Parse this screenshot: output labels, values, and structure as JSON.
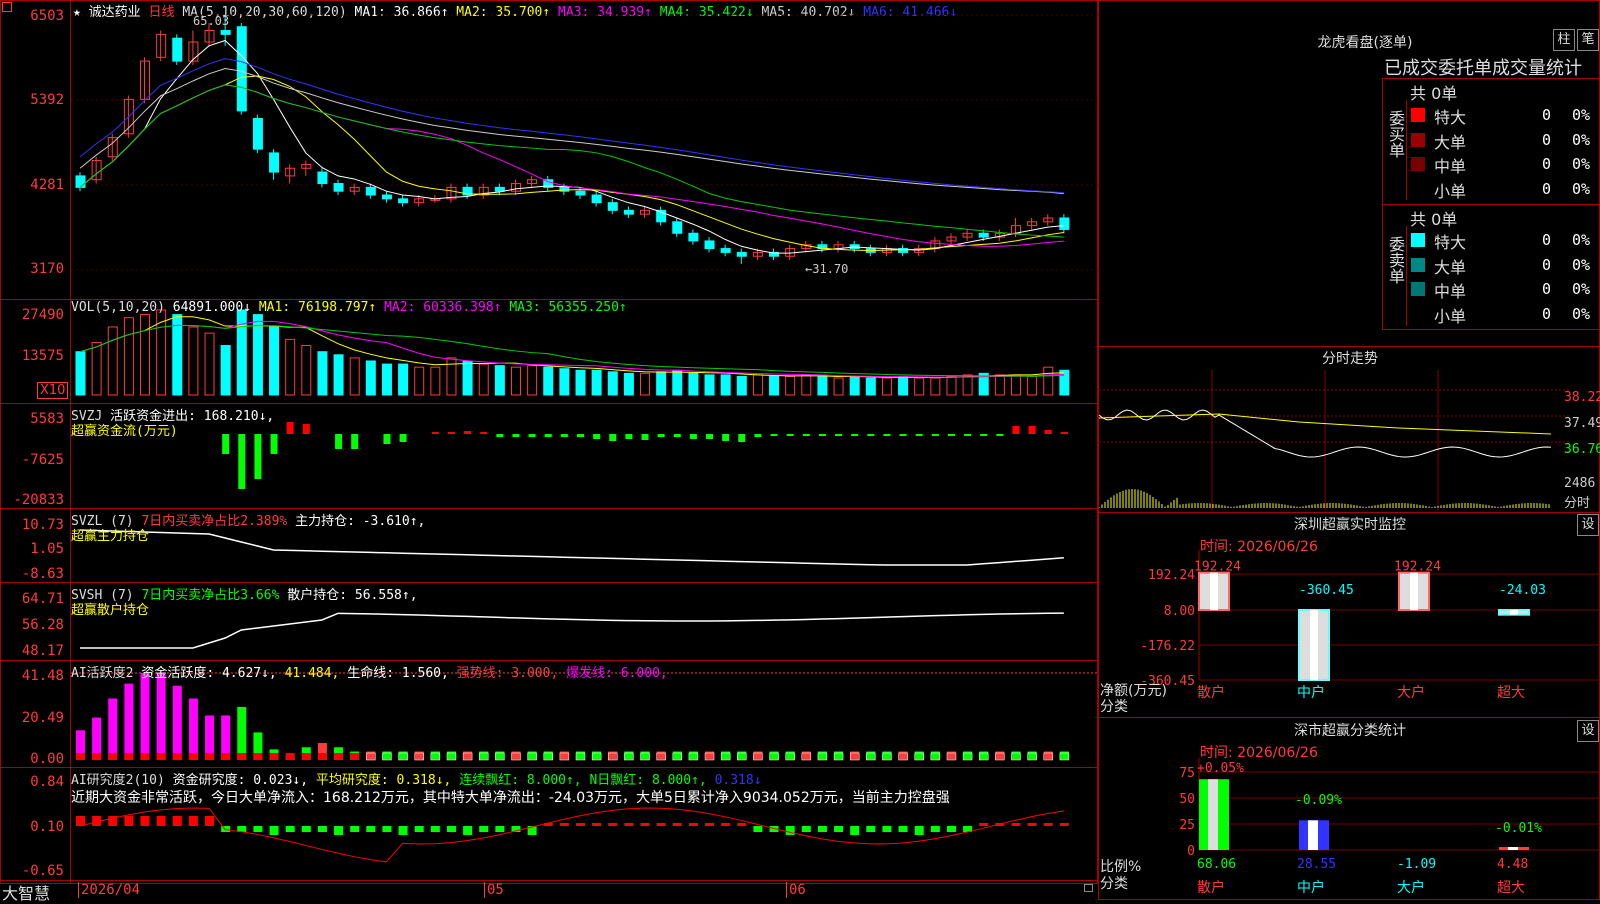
{
  "title": {
    "stock_name": "诚达药业",
    "period": "日线",
    "ma_prefix": "MA(5,10,20,30,60,120)",
    "ma": [
      {
        "label": "MA1: 36.866↑",
        "color": "#ffffff"
      },
      {
        "label": "MA2: 35.700↑",
        "color": "#ffff00"
      },
      {
        "label": "MA3: 34.939↑",
        "color": "#ff00ff"
      },
      {
        "label": "MA4: 35.422↓",
        "color": "#00ff00"
      },
      {
        "label": "MA5: 40.702↓",
        "color": "#cccccc"
      },
      {
        "label": "MA6: 41.466↓",
        "color": "#3333ff"
      }
    ]
  },
  "price_axis": [
    "6503",
    "5392",
    "4281",
    "3170"
  ],
  "price_annotations": {
    "high": "65.03",
    "low": "←31.70"
  },
  "vol": {
    "header": "VOL(5,10,20)",
    "value": "64891.000↓",
    "ma": [
      {
        "label": "MA1: 76198.797↑",
        "color": "#ffff00"
      },
      {
        "label": "MA2: 60336.398↑",
        "color": "#ff00ff"
      },
      {
        "label": "MA3: 56355.250↑",
        "color": "#00ff00"
      }
    ],
    "axis": [
      "27490",
      "13575"
    ],
    "unit": "X10"
  },
  "svzj": {
    "header": "SVZJ",
    "line1": "活跃资金进出: 168.210↓,",
    "line2": "超赢资金流(万元)",
    "axis": [
      "5583",
      "-7625",
      "-20833"
    ]
  },
  "svzl": {
    "header": "SVZL (7)",
    "desc": "7日内买卖净占比2.389%",
    "value": "主力持仓: -3.610↑,",
    "line2": "超赢主力持仓",
    "axis": [
      "10.73",
      "1.05",
      "-8.63"
    ]
  },
  "svsh": {
    "header": "SVSH (7)",
    "desc": "7日内买卖净占比3.66%",
    "value": "散户持仓: 56.558↑,",
    "line2": "超赢散户持仓",
    "axis": [
      "64.71",
      "56.28",
      "48.17"
    ]
  },
  "ai1": {
    "header": "AI活跃度2",
    "v1": "资金活跃度: 4.627↓,",
    "v2": "41.484,",
    "v3": "生命线: 1.560,",
    "v4": "强势线: 3.000,",
    "v5": "爆发线: 6.000,",
    "axis": [
      "41.48",
      "20.49",
      "0.00"
    ]
  },
  "ai2": {
    "header": "AI研究度2(10)",
    "v1": "资金研究度: 0.023↓,",
    "v2": "平均研究度: 0.318↓,",
    "v3": "连续飘红: 8.000↑,",
    "v4": "N日飘红: 8.000↑,",
    "v5": "0.318↓",
    "summary": "近期大资金非常活跃，今日大单净流入：168.212万元，其中特大单净流出：-24.03万元，大单5日累计净入9034.052万元，当前主力控盘强",
    "axis": [
      "0.84",
      "0.10",
      "-0.65"
    ]
  },
  "bottom_bar": {
    "brand": "大智慧",
    "dates": [
      "2026/04",
      "05",
      "06"
    ]
  },
  "right": {
    "dragon_title": "龙虎看盘(逐单)",
    "btn1": "柱",
    "btn2": "笔",
    "tabs_header": "已成交委托单成交量统计",
    "buy_side": "委买单",
    "sell_side": "委卖单",
    "buy_total": "共 0单",
    "sell_total": "共 0单",
    "buy_rows": [
      {
        "label": "特大",
        "count": "0",
        "pct": "0%",
        "color": "#ff0000"
      },
      {
        "label": "大单",
        "count": "0",
        "pct": "0%",
        "color": "#990000"
      },
      {
        "label": "中单",
        "count": "0",
        "pct": "0%",
        "color": "#770000"
      },
      {
        "label": "小单",
        "count": "0",
        "pct": "0%",
        "color": "#000000"
      }
    ],
    "sell_rows": [
      {
        "label": "特大",
        "count": "0",
        "pct": "0%",
        "color": "#00ffff"
      },
      {
        "label": "大单",
        "count": "0",
        "pct": "0%",
        "color": "#008888"
      },
      {
        "label": "中单",
        "count": "0",
        "pct": "0%",
        "color": "#007777"
      },
      {
        "label": "小单",
        "count": "0",
        "pct": "0%",
        "color": "#000000"
      }
    ],
    "minute_title": "分时走势",
    "minute_axis": [
      "38.22",
      "37.49",
      "36.76",
      "2486",
      "分时"
    ],
    "sz_monitor_title": "深圳超赢实时监控",
    "sz_monitor_time": "时间: 2026/06/26",
    "sz_monitor_axis": [
      "192.24",
      "8.00",
      "-176.22",
      "-360.45"
    ],
    "sz_monitor_ylabel1": "净额(万元)",
    "sz_monitor_ylabel2": "分类",
    "sz_monitor_values": [
      "192.24",
      "-360.45",
      "192.24",
      "-24.03"
    ],
    "categories": [
      "散户",
      "中户",
      "大户",
      "超大"
    ],
    "set_label": "设",
    "sz_class_title": "深市超赢分类统计",
    "sz_class_time": "时间: 2026/06/26",
    "sz_class_axis": [
      "75",
      "50",
      "25",
      "0"
    ],
    "sz_class_top": [
      "+0.05%",
      "-0.09%",
      "-0.01%"
    ],
    "sz_class_ylabel1": "比例%",
    "sz_class_ylabel2": "分类",
    "sz_class_values": [
      "68.06",
      "28.55",
      "-1.09",
      "4.48"
    ]
  },
  "chart_data": [
    {
      "type": "candlestick",
      "title": "诚达药业 日线",
      "ylim": [
        3170,
        6503
      ],
      "note": "price axis values as printed (x100)",
      "candles": [
        [
          4400,
          4250,
          4450,
          4200
        ],
        [
          4350,
          4600,
          4650,
          4300
        ],
        [
          4650,
          4900,
          4950,
          4600
        ],
        [
          4950,
          5400,
          5450,
          4900
        ],
        [
          5400,
          5900,
          5950,
          5350
        ],
        [
          5950,
          6250,
          6300,
          5900
        ],
        [
          6200,
          5900,
          6250,
          5850
        ],
        [
          5900,
          6150,
          6300,
          5850
        ],
        [
          6150,
          6300,
          6400,
          6100
        ],
        [
          6300,
          6250,
          6503,
          6100
        ],
        [
          6350,
          5250,
          6400,
          5200
        ],
        [
          5150,
          4750,
          5200,
          4700
        ],
        [
          4700,
          4450,
          4750,
          4350
        ],
        [
          4400,
          4500,
          4550,
          4300
        ],
        [
          4500,
          4550,
          4600,
          4400
        ],
        [
          4450,
          4300,
          4500,
          4250
        ],
        [
          4300,
          4200,
          4350,
          4150
        ],
        [
          4200,
          4250,
          4300,
          4150
        ],
        [
          4250,
          4150,
          4300,
          4100
        ],
        [
          4150,
          4100,
          4200,
          4050
        ],
        [
          4100,
          4050,
          4150,
          4000
        ],
        [
          4050,
          4100,
          4150,
          4000
        ],
        [
          4100,
          4100,
          4150,
          4050
        ],
        [
          4100,
          4250,
          4300,
          4050
        ],
        [
          4250,
          4150,
          4300,
          4100
        ],
        [
          4150,
          4250,
          4300,
          4100
        ],
        [
          4250,
          4200,
          4300,
          4150
        ],
        [
          4200,
          4300,
          4350,
          4150
        ],
        [
          4300,
          4350,
          4400,
          4250
        ],
        [
          4350,
          4250,
          4400,
          4200
        ],
        [
          4250,
          4200,
          4300,
          4150
        ],
        [
          4200,
          4150,
          4250,
          4100
        ],
        [
          4150,
          4050,
          4200,
          4000
        ],
        [
          4050,
          3950,
          4100,
          3900
        ],
        [
          3950,
          3900,
          4000,
          3850
        ],
        [
          3900,
          3950,
          4000,
          3850
        ],
        [
          3950,
          3800,
          4000,
          3750
        ],
        [
          3800,
          3650,
          3850,
          3600
        ],
        [
          3650,
          3550,
          3700,
          3500
        ],
        [
          3550,
          3450,
          3600,
          3400
        ],
        [
          3450,
          3400,
          3500,
          3350
        ],
        [
          3400,
          3350,
          3450,
          3250
        ],
        [
          3350,
          3400,
          3450,
          3300
        ],
        [
          3400,
          3350,
          3450,
          3300
        ],
        [
          3350,
          3450,
          3500,
          3300
        ],
        [
          3450,
          3500,
          3550,
          3400
        ],
        [
          3500,
          3450,
          3550,
          3400
        ],
        [
          3450,
          3500,
          3550,
          3400
        ],
        [
          3500,
          3450,
          3550,
          3400
        ],
        [
          3450,
          3400,
          3500,
          3350
        ],
        [
          3400,
          3450,
          3500,
          3350
        ],
        [
          3450,
          3400,
          3500,
          3350
        ],
        [
          3400,
          3450,
          3500,
          3350
        ],
        [
          3450,
          3550,
          3600,
          3400
        ],
        [
          3550,
          3600,
          3650,
          3500
        ],
        [
          3600,
          3650,
          3700,
          3550
        ],
        [
          3650,
          3600,
          3700,
          3550
        ],
        [
          3600,
          3650,
          3700,
          3550
        ],
        [
          3650,
          3750,
          3850,
          3600
        ],
        [
          3750,
          3800,
          3850,
          3700
        ],
        [
          3800,
          3850,
          3900,
          3750
        ],
        [
          3850,
          3700,
          3900,
          3650
        ]
      ]
    },
    {
      "type": "bar",
      "title": "VOL(5,10,20)",
      "ylim": [
        0,
        27490
      ],
      "values": [
        14000,
        17000,
        22000,
        25000,
        26000,
        27490,
        26000,
        22000,
        20000,
        16000,
        27490,
        26000,
        22000,
        18000,
        16000,
        14000,
        13000,
        12000,
        11000,
        10000,
        10000,
        9000,
        9000,
        12000,
        11000,
        10000,
        9500,
        9000,
        9500,
        9000,
        8500,
        8000,
        8000,
        7500,
        7000,
        7000,
        7500,
        8000,
        7000,
        6500,
        6500,
        6000,
        6500,
        6000,
        6000,
        6500,
        6000,
        5500,
        6000,
        5500,
        5500,
        6000,
        5500,
        5500,
        6000,
        6500,
        7000,
        6500,
        6500,
        6000,
        9000,
        8000
      ]
    }
  ]
}
